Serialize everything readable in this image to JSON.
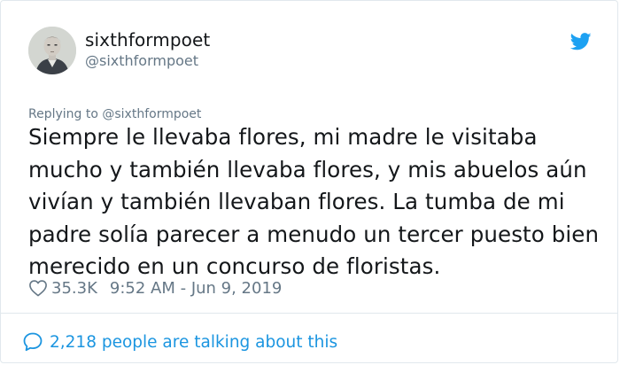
{
  "author": {
    "display_name": "sixthformpoet",
    "handle": "@sixthformpoet"
  },
  "icons": {
    "brand": "twitter-bird-icon",
    "like": "heart-icon",
    "conversation": "speech-bubble-icon"
  },
  "colors": {
    "brand_blue": "#1da1f2",
    "link_blue": "#1b95e0",
    "text_primary": "#14171a",
    "text_secondary": "#657786"
  },
  "tweet": {
    "replying_to": "Replying to @sixthformpoet",
    "text": "Siempre le llevaba flores, mi madre le visitaba mucho y también llevaba flores, y mis abuelos aún vivían y también llevaban flores. La tumba de mi padre solía parecer a menudo un tercer puesto bien merecido en un concurso de floristas.",
    "likes": "35.3K",
    "timestamp": "9:52 AM - Jun 9, 2019"
  },
  "footer": {
    "talking_text": "2,218 people are talking about this"
  }
}
